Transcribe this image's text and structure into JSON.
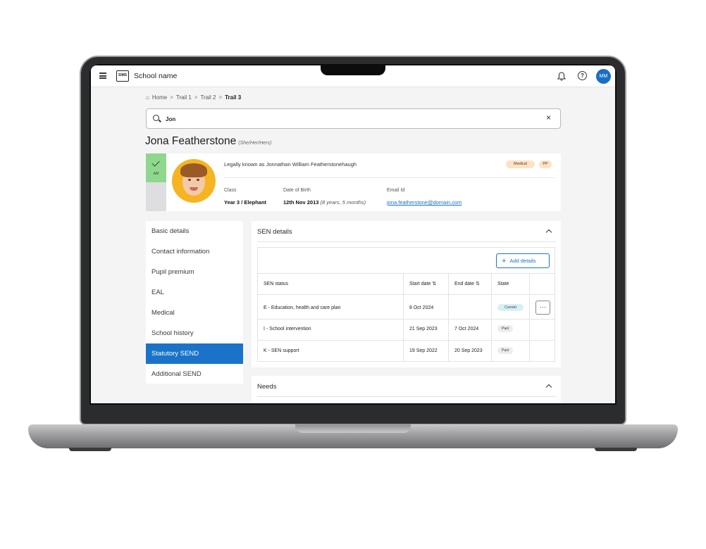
{
  "topbar": {
    "logo_text": "SIMS",
    "school_name": "School name",
    "help_symbol": "?",
    "user_initials": "MM"
  },
  "breadcrumb": {
    "home_icon": "⌂",
    "items": [
      "Home",
      "Trail 1",
      "Trail 2",
      "Trail 3"
    ],
    "separator": ">"
  },
  "search": {
    "value": "Jon",
    "clear_symbol": "×"
  },
  "pupil": {
    "name": "Jona Featherstone",
    "pronouns": "(She/Her/Hers)",
    "attendance": "AM",
    "legal_name": "Legally known as Jonnathan William Featherstonehaugh",
    "badges": [
      "Medical",
      "PP"
    ],
    "class_label": "Class",
    "class_value": "Year 3 / Elephant",
    "dob_label": "Date of Birth",
    "dob_value": "12th Nov 2013",
    "age": "(8 years, 5 months)",
    "email_label": "Email Id",
    "email_value": "jona.featherstone@domain.com"
  },
  "sidenav": {
    "items": [
      "Basic details",
      "Contact information",
      "Pupil premium",
      "EAL",
      "Medical",
      "School history",
      "Statutory SEND",
      "Additional SEND"
    ],
    "active": "Statutory SEND"
  },
  "sen_panel": {
    "title": "SEN details",
    "add_button": "Add details",
    "add_symbol": "+",
    "more_symbol": "···",
    "columns": [
      "SEN status",
      "Start date ⇅",
      "End date ⇅",
      "State"
    ],
    "rows": [
      {
        "status": "E - Education, health and care plan",
        "start": "8 Oct 2024",
        "end": "",
        "state": "Current"
      },
      {
        "status": "I - School intervention",
        "start": "21 Sep 2023",
        "end": "7 Oct 2024",
        "state": "Past"
      },
      {
        "status": "K - SEN support",
        "start": "19 Sep 2022",
        "end": "20 Sep 2023",
        "state": "Past"
      }
    ]
  },
  "needs_panel": {
    "title": "Needs"
  },
  "colors": {
    "accent": "#1a73c8",
    "attendance_present": "#8fd78c",
    "badge_bg": "#fde2c7",
    "current_bg": "#d7f0f5"
  }
}
